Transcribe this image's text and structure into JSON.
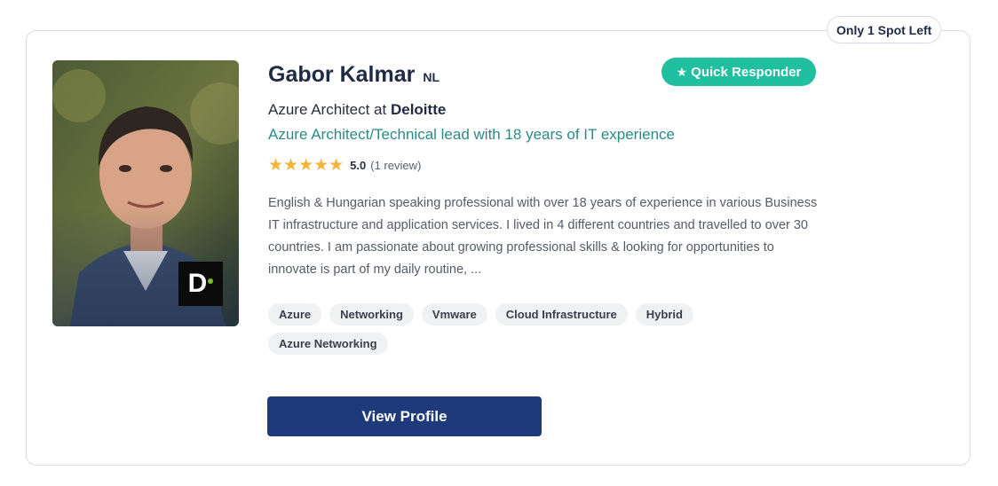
{
  "card": {
    "spot_badge": "Only 1 Spot Left",
    "name": "Gabor Kalmar",
    "country": "NL",
    "quick_responder": "Quick Responder",
    "role": "Azure Architect at",
    "company": "Deloitte",
    "company_logo_letter": "D",
    "headline": "Azure Architect/Technical lead with 18 years of IT experience",
    "rating": {
      "stars": 5,
      "value": "5.0",
      "reviews": "(1 review)"
    },
    "bio": "English & Hungarian speaking professional with over 18 years of experience in various Business IT infrastructure and application services. I lived in 4 different countries and travelled to over 30 countries. I am passionate about growing professional skills & looking for opportunities to innovate is part of my daily routine, ...",
    "tags": [
      "Azure",
      "Networking",
      "Vmware",
      "Cloud Infrastructure",
      "Hybrid",
      "Azure Networking"
    ],
    "view_profile": "View Profile"
  },
  "colors": {
    "accent_teal": "#1fbf9f",
    "headline_teal": "#2a8b85",
    "button_navy": "#1e3a7b",
    "star_gold": "#f2b53a",
    "logo_green": "#86bc25"
  }
}
